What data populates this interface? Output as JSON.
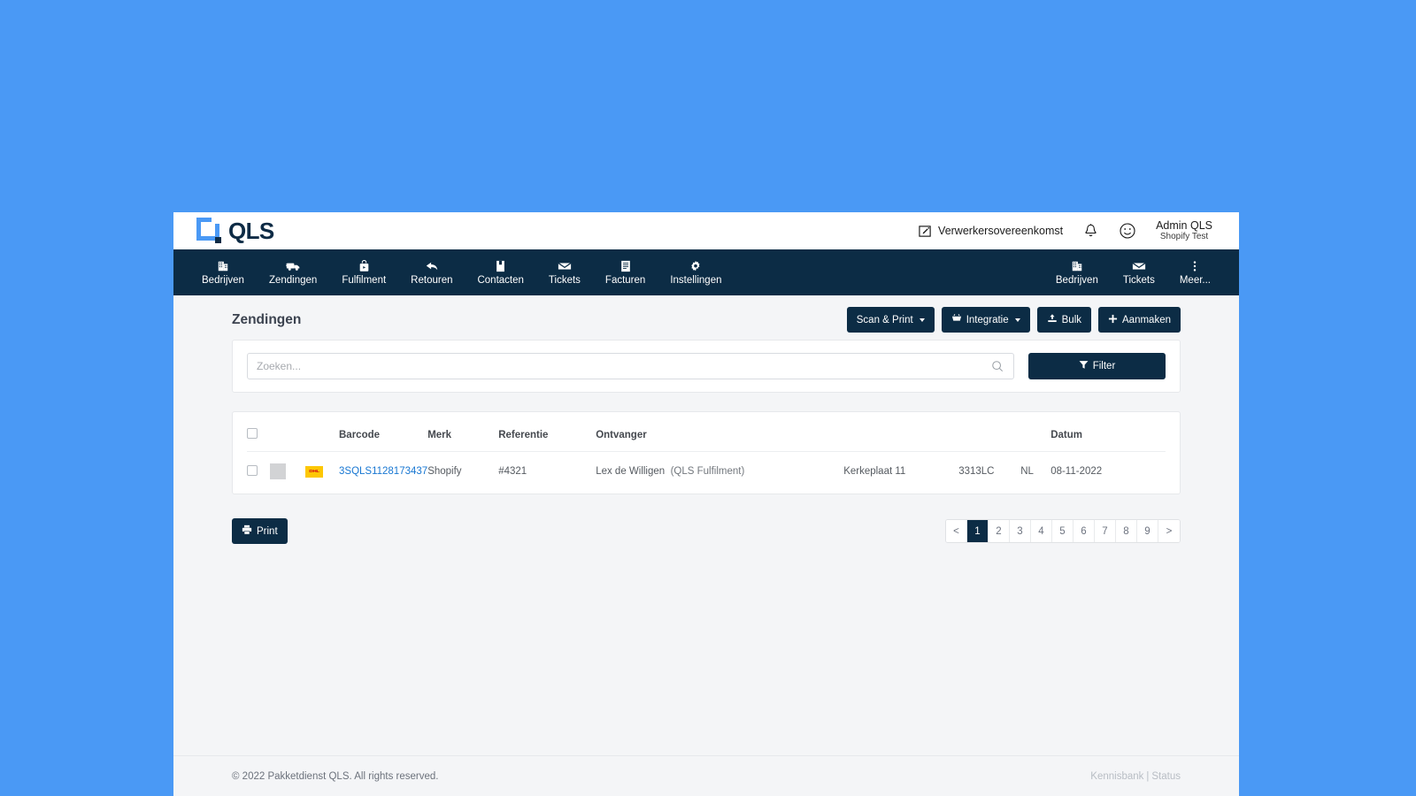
{
  "brand": {
    "logo_text": "QLS",
    "logo_blue": "#4a99f5",
    "navy": "#0c2c45",
    "page_bg": "#4a99f5"
  },
  "topbar": {
    "agreement_link": "Verwerkersovereenkomst",
    "notifications_icon": "bell-icon",
    "support_icon": "smiley-icon",
    "user_name": "Admin QLS",
    "user_org": "Shopify Test"
  },
  "nav": {
    "primary": [
      {
        "label": "Bedrijven",
        "icon": "building-icon"
      },
      {
        "label": "Zendingen",
        "icon": "truck-icon"
      },
      {
        "label": "Fulfilment",
        "icon": "box-icon"
      },
      {
        "label": "Retouren",
        "icon": "return-arrow-icon"
      },
      {
        "label": "Contacten",
        "icon": "contact-card-icon"
      },
      {
        "label": "Tickets",
        "icon": "envelope-icon"
      },
      {
        "label": "Facturen",
        "icon": "invoice-icon"
      },
      {
        "label": "Instellingen",
        "icon": "gear-icon"
      }
    ],
    "secondary": [
      {
        "label": "Bedrijven",
        "icon": "building-icon"
      },
      {
        "label": "Tickets",
        "icon": "envelope-icon"
      },
      {
        "label": "Meer...",
        "icon": "more-vertical-icon"
      }
    ]
  },
  "page": {
    "title": "Zendingen",
    "actions": [
      {
        "label": "Scan & Print",
        "icon": null,
        "caret": true
      },
      {
        "label": "Integratie",
        "icon": "cart-icon",
        "caret": true
      },
      {
        "label": "Bulk",
        "icon": "upload-icon",
        "caret": false
      },
      {
        "label": "Aanmaken",
        "icon": "plus-icon",
        "caret": false
      }
    ]
  },
  "search": {
    "placeholder": "Zoeken...",
    "value": "",
    "icon": "search-icon",
    "filter_label": "Filter",
    "filter_icon": "funnel-icon"
  },
  "table": {
    "headers": [
      "",
      "",
      "",
      "Barcode",
      "Merk",
      "Referentie",
      "Ontvanger",
      "",
      "",
      "",
      "Datum"
    ],
    "columns": {
      "barcode": "Barcode",
      "merk": "Merk",
      "referentie": "Referentie",
      "ontvanger": "Ontvanger",
      "datum": "Datum"
    },
    "rows": [
      {
        "carrier": "DHL",
        "barcode": "3SQLS1128173437",
        "merk": "Shopify",
        "referentie": "#4321",
        "ontvanger_name": "Lex de Willigen",
        "ontvanger_company": "(QLS Fulfilment)",
        "street": "Kerkeplaat 11",
        "postcode": "3313LC",
        "country": "NL",
        "datum": "08-11-2022"
      }
    ]
  },
  "bottom": {
    "print_label": "Print",
    "print_icon": "printer-icon",
    "pagination": {
      "prev": "<",
      "next": ">",
      "pages": [
        "1",
        "2",
        "3",
        "4",
        "5",
        "6",
        "7",
        "8",
        "9"
      ],
      "active": "1"
    }
  },
  "footer": {
    "copyright": "© 2022 Pakketdienst QLS. All rights reserved.",
    "link_kb": "Kennisbank",
    "separator": "|",
    "link_status": "Status"
  }
}
